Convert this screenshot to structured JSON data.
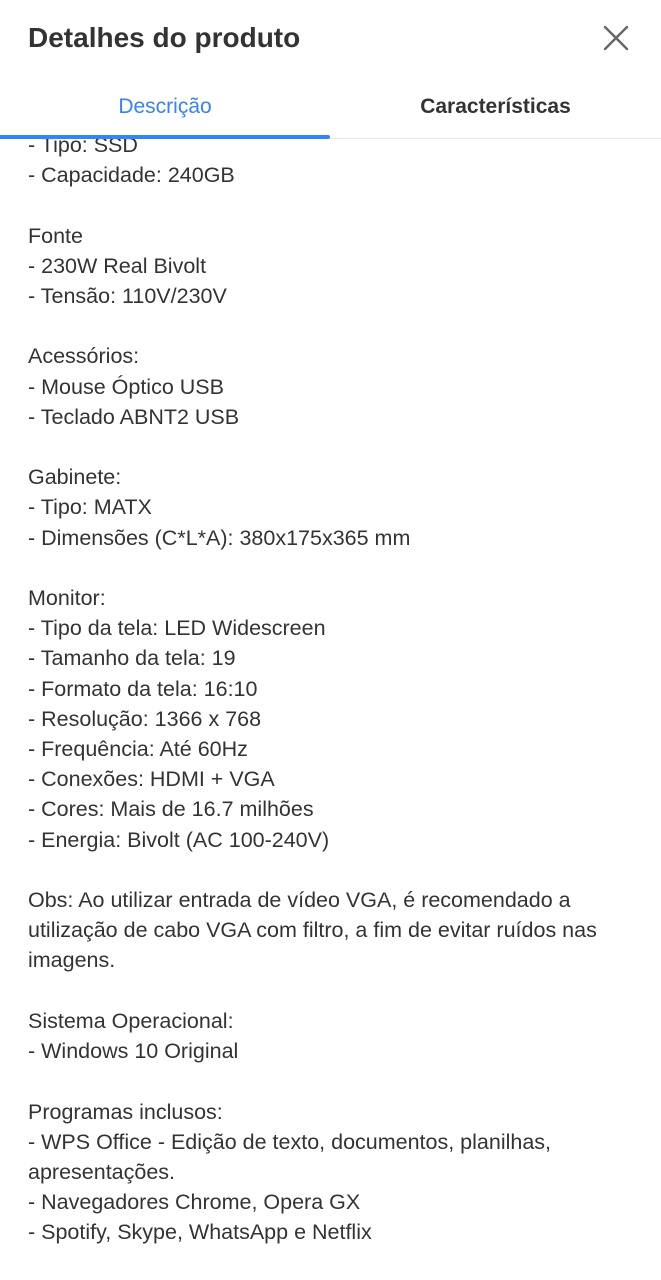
{
  "modal": {
    "title": "Detalhes do produto",
    "close_icon": "close-icon"
  },
  "tabs": [
    {
      "label": "Descrição",
      "active": true
    },
    {
      "label": "Características",
      "active": false
    }
  ],
  "colors": {
    "accent": "#3483fa",
    "text": "#333333",
    "divider": "#e6e6e6"
  },
  "description": {
    "text": "- Tipo: SSD\n- Capacidade: 240GB\n\nFonte\n- 230W Real Bivolt\n- Tensão: 110V/230V\n\nAcessórios:\n- Mouse Óptico USB\n- Teclado ABNT2 USB\n\nGabinete:\n- Tipo: MATX\n- Dimensões (C*L*A): 380x175x365 mm\n\nMonitor:\n- Tipo da tela: LED Widescreen\n- Tamanho da tela: 19\n- Formato da tela: 16:10\n- Resolução: 1366 x 768\n- Frequência: Até 60Hz\n- Conexões: HDMI + VGA\n- Cores: Mais de 16.7 milhões\n- Energia: Bivolt (AC 100-240V)\n\nObs: Ao utilizar entrada de vídeo VGA, é recomendado a utilização de cabo VGA com filtro, a fim de evitar ruídos nas imagens.\n\nSistema Operacional:\n- Windows 10 Original\n\nProgramas inclusos:\n- WPS Office - Edição de texto, documentos, planilhas, apresentações.\n- Navegadores Chrome, Opera GX\n- Spotify, Skype, WhatsApp e Netflix"
  }
}
